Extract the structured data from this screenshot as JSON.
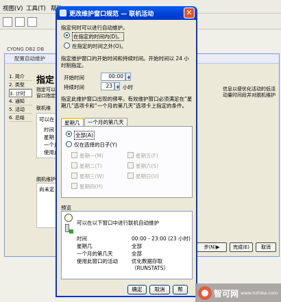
{
  "background": {
    "menu": [
      "视图(V)",
      "工具(T)",
      "帮助"
    ],
    "address": "CYONG  DB2  DB",
    "window_title": "配置自动维护",
    "steps": [
      "1. 简介",
      "2. 类型",
      "3. 计时",
      "4. 通知",
      "5. 活动",
      "6. 总结"
    ],
    "heading": "指定",
    "desc_lines": [
      "指定可以",
      "窗口指定"
    ],
    "right_desc": "信息以便优化活动的低活动量时间段并对脱机维护",
    "online_label": "联机维",
    "group_lines": [
      "可以在",
      "时间",
      "星期",
      "一个月",
      "使用此"
    ],
    "offline_label": "脱机维护",
    "offline_text": "尚未定",
    "buttons": [
      "步(N)▶",
      "完成(E)",
      "取消"
    ]
  },
  "dialog": {
    "title": "更改维护窗口规范 — 联机活动",
    "close_glyph": "✕",
    "section1_label": "指定何时可以进行自动维护。",
    "radio_within": "在指定的时间内(D)。",
    "radio_outside": "在指定的时间之外(O)。",
    "section2_label": "指定维护窗口的开始时间和持续时间。开始时间以 24 小时制指定。",
    "start_label": "开始时间",
    "start_value": "00:00",
    "duration_label": "持续时间",
    "duration_value": "23",
    "duration_unit": "小时",
    "section3_label": "指定此维护窗口出现的频率。有效维护窗口必须满足在“星期几”选项卡和“一个月的第几天”选项卡上指定的条件。",
    "tabs": [
      "星期几",
      "一个月的第几天"
    ],
    "radio_all": "全部(A)",
    "radio_selected_days": "仅在选择的日子(Y)",
    "days_left": [
      "星期一(M)",
      "星期二(T)",
      "星期三(W)",
      "星期四(H)"
    ],
    "days_right": [
      "星期五(F)",
      "星期六(S)",
      "星期日(U)"
    ],
    "preview_label": "预览",
    "preview_message": "可以在以下窗口中进行联机自动维护",
    "preview_rows": [
      {
        "key": "时间",
        "value": "00:00 - 23:00 (23 小时)"
      },
      {
        "key": "星期几",
        "value": "全部"
      },
      {
        "key": "一个月的第几天",
        "value": "全部"
      },
      {
        "key": "使用此窗口的活动",
        "value": "优化数据存取"
      }
    ],
    "preview_extra": "（RUNSTATS）",
    "buttons": {
      "ok": "确定",
      "cancel": "取消",
      "help": "帮"
    }
  },
  "watermark": {
    "name": "智可网",
    "url": "www.hzhike.com"
  }
}
